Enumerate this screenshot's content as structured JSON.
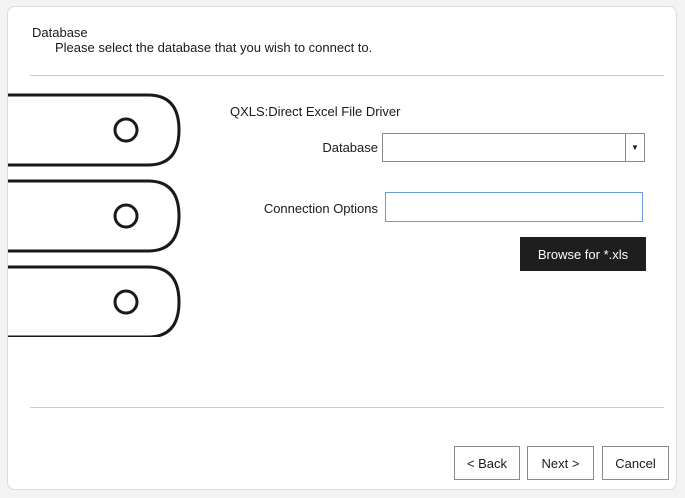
{
  "header": {
    "title": "Database",
    "subtitle": "Please select the database that you wish to connect to."
  },
  "driver": {
    "name": "QXLS:Direct Excel File Driver"
  },
  "form": {
    "database_label": "Database",
    "database_value": "",
    "connection_options_label": "Connection Options",
    "connection_options_value": ""
  },
  "buttons": {
    "browse": "Browse for *.xls",
    "back": "< Back",
    "next": "Next >",
    "cancel": "Cancel"
  },
  "icons": {
    "illustration": "database-disks-icon",
    "dropdown": "chevron-down-icon"
  }
}
